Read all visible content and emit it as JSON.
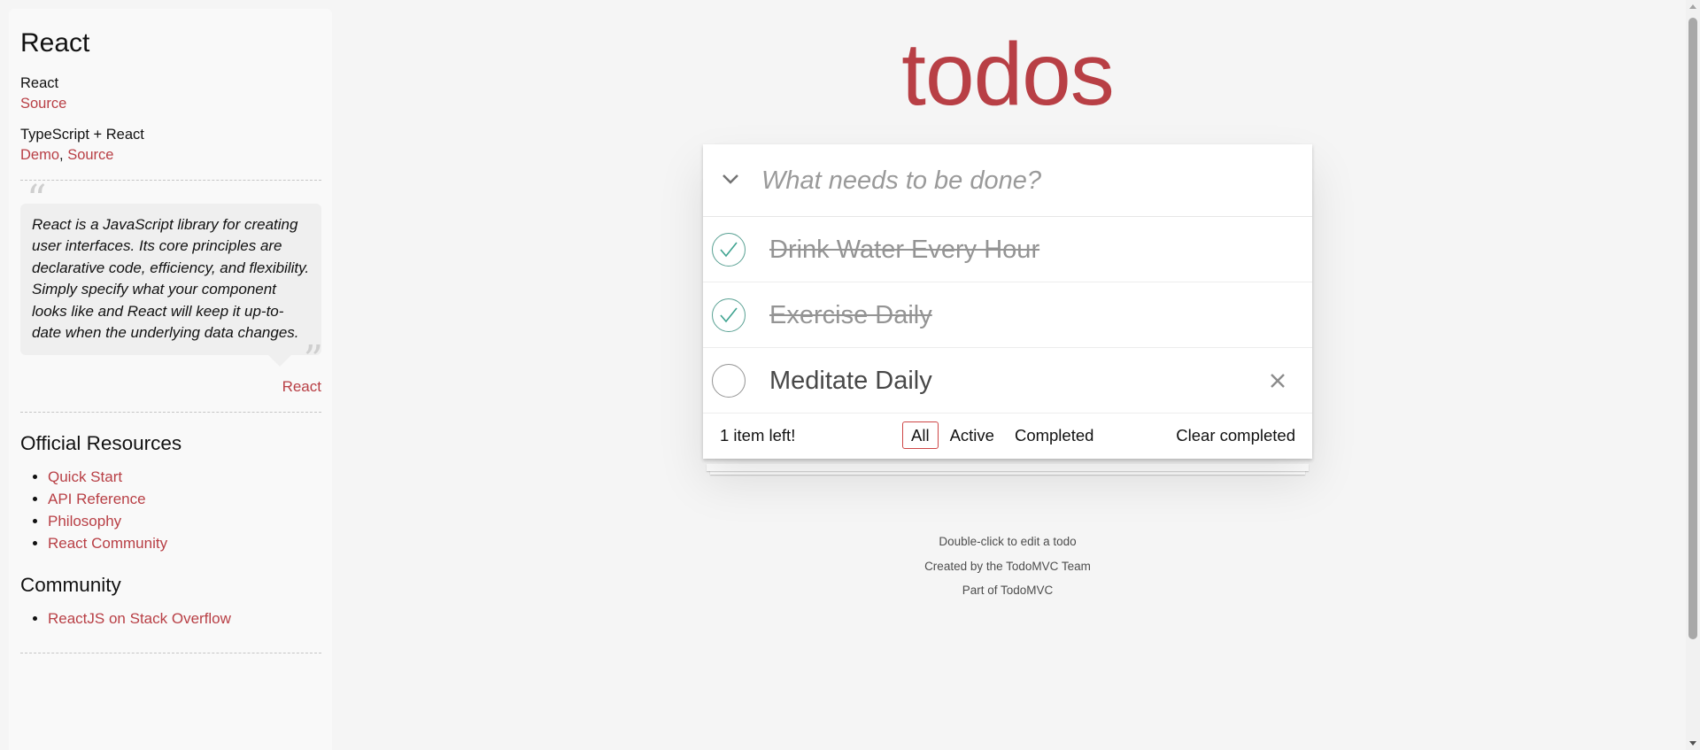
{
  "sidebar": {
    "title": "React",
    "examples": [
      {
        "name": "React",
        "links": [
          "Source"
        ]
      },
      {
        "name": "TypeScript + React",
        "links": [
          "Demo",
          "Source"
        ],
        "separator": ", "
      }
    ],
    "quote": {
      "text": "React is a JavaScript library for creating user interfaces. Its core principles are declarative code, efficiency, and flexibility. Simply specify what your component looks like and React will keep it up-to-date when the underlying data changes.",
      "source": "React",
      "open_mark": "“",
      "close_mark": "”"
    },
    "official": {
      "heading": "Official Resources",
      "items": [
        "Quick Start",
        "API Reference",
        "Philosophy",
        "React Community"
      ]
    },
    "community": {
      "heading": "Community",
      "items": [
        "ReactJS on Stack Overflow"
      ]
    }
  },
  "app": {
    "title": "todos",
    "new_todo_placeholder": "What needs to be done?",
    "new_todo_value": "",
    "todos": [
      {
        "label": "Drink Water Every Hour",
        "completed": true
      },
      {
        "label": "Exercise Daily",
        "completed": true
      },
      {
        "label": "Meditate Daily",
        "completed": false
      }
    ],
    "footer": {
      "count_text": "1 item left!",
      "filters": [
        "All",
        "Active",
        "Completed"
      ],
      "selected_filter": "All",
      "clear_label": "Clear completed"
    }
  },
  "info": {
    "line1": "Double-click to edit a todo",
    "line2": "Created by the TodoMVC Team",
    "line3": "Part of TodoMVC"
  },
  "colors": {
    "accent": "#b83f45",
    "check_done": "#59a193",
    "filter_border": "#ce4646",
    "background": "#f5f5f5"
  },
  "icons": {
    "toggle_all": "chevron-down-icon",
    "check": "checkmark-icon",
    "destroy": "close-icon"
  }
}
